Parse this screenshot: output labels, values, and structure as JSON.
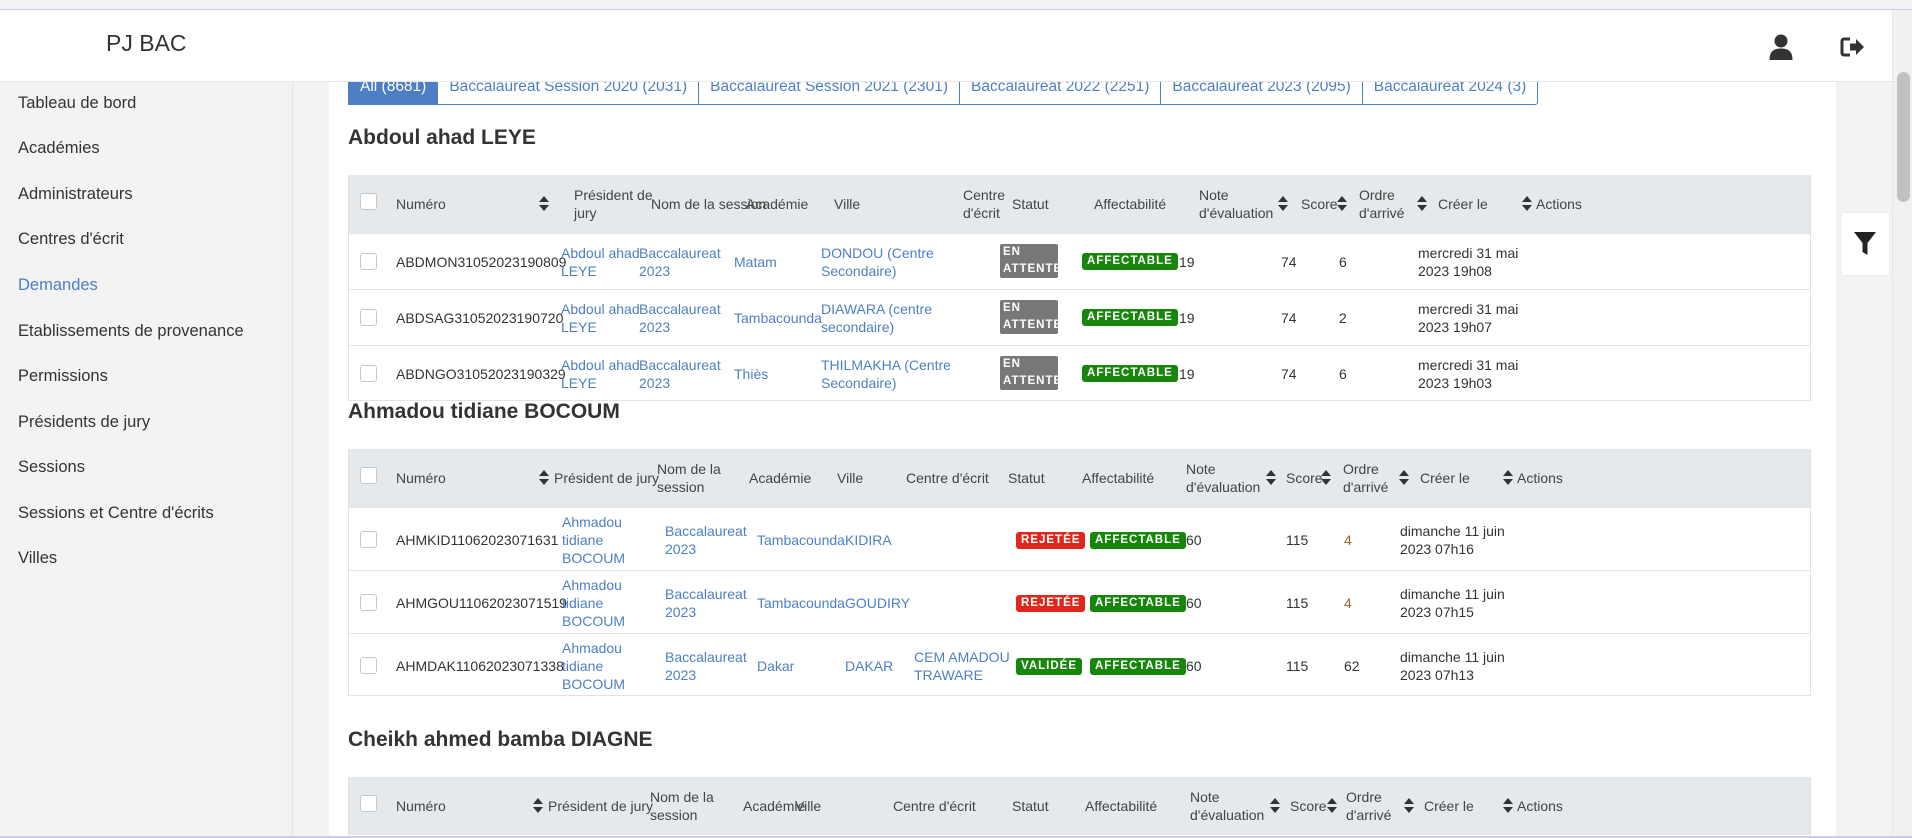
{
  "app": {
    "brand": "PJ BAC"
  },
  "header": {
    "user_icon": "user-icon",
    "logout_icon": "logout-icon"
  },
  "sidebar": {
    "items": [
      {
        "label": "Tableau de bord"
      },
      {
        "label": "Académies"
      },
      {
        "label": "Administrateurs"
      },
      {
        "label": "Centres d'écrit"
      },
      {
        "label": "Demandes",
        "active": true
      },
      {
        "label": "Etablissements de provenance"
      },
      {
        "label": "Permissions"
      },
      {
        "label": "Présidents de jury"
      },
      {
        "label": "Sessions"
      },
      {
        "label": "Sessions et Centre d'écrits"
      },
      {
        "label": "Villes"
      }
    ]
  },
  "tabs": [
    {
      "label": "All (8681)"
    },
    {
      "label": "Baccalaureat Session 2020 (2031)"
    },
    {
      "label": "Baccalaureat Session 2021 (2301)"
    },
    {
      "label": "Baccalaureat 2022 (2251)"
    },
    {
      "label": "Baccalaureat 2023 (2095)"
    },
    {
      "label": "Baccalaureat 2024 (3)"
    }
  ],
  "columns": {
    "numero": "Numéro",
    "president": "Président de jury",
    "session": "Nom de la session",
    "academie": "Académie",
    "ville": "Ville",
    "centre": "Centre d'écrit",
    "statut": "Statut",
    "affectabilite": "Affectabilité",
    "note": "Note d'évaluation",
    "score": "Score",
    "ordre": "Ordre d'arrivé",
    "cree": "Créer le",
    "actions": "Actions"
  },
  "groups": [
    {
      "title": "Abdoul ahad LEYE",
      "rows": [
        {
          "numero": "ABDMON31052023190809",
          "president": "Abdoul ahad LEYE",
          "session": "Baccalaureat 2023",
          "academie": "Matam",
          "ville": "DONDOU (Centre Secondaire)",
          "centre": "",
          "statut": "EN ATTENTE",
          "affectabilite": "AFFECTABLE",
          "note": "19",
          "score": "74",
          "ordre": "6",
          "cree": "mercredi 31 mai 2023 19h08"
        },
        {
          "numero": "ABDSAG31052023190720",
          "president": "Abdoul ahad LEYE",
          "session": "Baccalaureat 2023",
          "academie": "Tambacounda",
          "ville": "DIAWARA (centre secondaire)",
          "centre": "",
          "statut": "EN ATTENTE",
          "affectabilite": "AFFECTABLE",
          "note": "19",
          "score": "74",
          "ordre": "2",
          "cree": "mercredi 31 mai 2023 19h07"
        },
        {
          "numero": "ABDNGO31052023190329",
          "president": "Abdoul ahad LEYE",
          "session": "Baccalaureat 2023",
          "academie": "Thiès",
          "ville": "THILMAKHA (Centre Secondaire)",
          "centre": "",
          "statut": "EN ATTENTE",
          "affectabilite": "AFFECTABLE",
          "note": "19",
          "score": "74",
          "ordre": "6",
          "cree": "mercredi 31 mai 2023 19h03"
        }
      ]
    },
    {
      "title": "Ahmadou tidiane BOCOUM",
      "rows": [
        {
          "numero": "AHMKID11062023071631",
          "president": "Ahmadou tidiane BOCOUM",
          "session": "Baccalaureat 2023",
          "academie": "Tambacounda",
          "ville": "KIDIRA",
          "centre": "",
          "statut": "REJETÉE",
          "affectabilite": "AFFECTABLE",
          "note": "60",
          "score": "115",
          "ordre": "4",
          "cree": "dimanche 11 juin 2023 07h16"
        },
        {
          "numero": "AHMGOU11062023071519",
          "president": "Ahmadou tidiane BOCOUM",
          "session": "Baccalaureat 2023",
          "academie": "Tambacounda",
          "ville": "GOUDIRY",
          "centre": "",
          "statut": "REJETÉE",
          "affectabilite": "AFFECTABLE",
          "note": "60",
          "score": "115",
          "ordre": "4",
          "cree": "dimanche 11 juin 2023 07h15"
        },
        {
          "numero": "AHMDAK11062023071338",
          "president": "Ahmadou tidiane BOCOUM",
          "session": "Baccalaureat 2023",
          "academie": "Dakar",
          "ville": "DAKAR",
          "centre": "CEM AMADOU TRAWARE",
          "statut": "VALIDÉE",
          "affectabilite": "AFFECTABLE",
          "note": "60",
          "score": "115",
          "ordre": "62",
          "cree": "dimanche 11 juin 2023 07h13"
        }
      ]
    },
    {
      "title": "Cheikh ahmed bamba DIAGNE",
      "rows": []
    }
  ],
  "colors": {
    "accent": "#4e7fc4",
    "affectable": "#16870b",
    "rejetee": "#e0271c",
    "validee": "#16870b",
    "en_attente": "#777777"
  },
  "filter_icon": "filter-icon"
}
